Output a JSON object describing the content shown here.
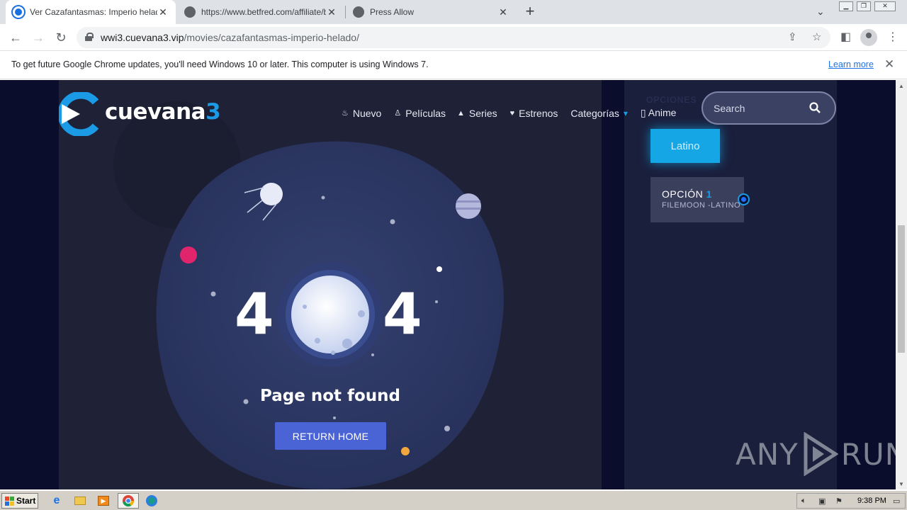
{
  "browser": {
    "tabs": [
      {
        "title": "Ver Cazafantasmas: Imperio helado",
        "active": true
      },
      {
        "title": "https://www.betfred.com/affiliate/b",
        "active": false
      },
      {
        "title": "Press Allow",
        "active": false
      }
    ],
    "address": {
      "host": "wwi3.cuevana3.vip",
      "path": "/movies/cazafantasmas-imperio-helado/"
    },
    "infobar": {
      "message": "To get future Google Chrome updates, you'll need Windows 10 or later. This computer is using Windows 7.",
      "link": "Learn more"
    }
  },
  "site": {
    "logo": {
      "word": "cuevana",
      "number": "3"
    },
    "nav": [
      {
        "label": "Nuevo",
        "icon": "flame-icon"
      },
      {
        "label": "Películas",
        "icon": "person-icon"
      },
      {
        "label": "Series",
        "icon": "triangle-icon"
      },
      {
        "label": "Estrenos",
        "icon": "heart-icon"
      },
      {
        "label": "Categorías",
        "icon": "chevron-down-icon"
      },
      {
        "label": "▯ Anime",
        "icon": ""
      }
    ],
    "search": {
      "placeholder": "Search"
    },
    "sidebar": {
      "options_heading": "OPCIONES",
      "language_button": "Latino",
      "option": {
        "label": "OPCIÓN",
        "number": "1",
        "server": "FILEMOON -LATINO"
      }
    },
    "error": {
      "digit_left": "4",
      "digit_right": "4",
      "message": "Page not found",
      "button": "RETURN HOME"
    }
  },
  "watermark": {
    "left": "ANY",
    "right": "RUN"
  },
  "taskbar": {
    "start": "Start",
    "clock": "9:38 PM"
  },
  "colors": {
    "accent": "#1b9ae6",
    "page_bg": "#0a0e2c",
    "button": "#4a64d6"
  }
}
